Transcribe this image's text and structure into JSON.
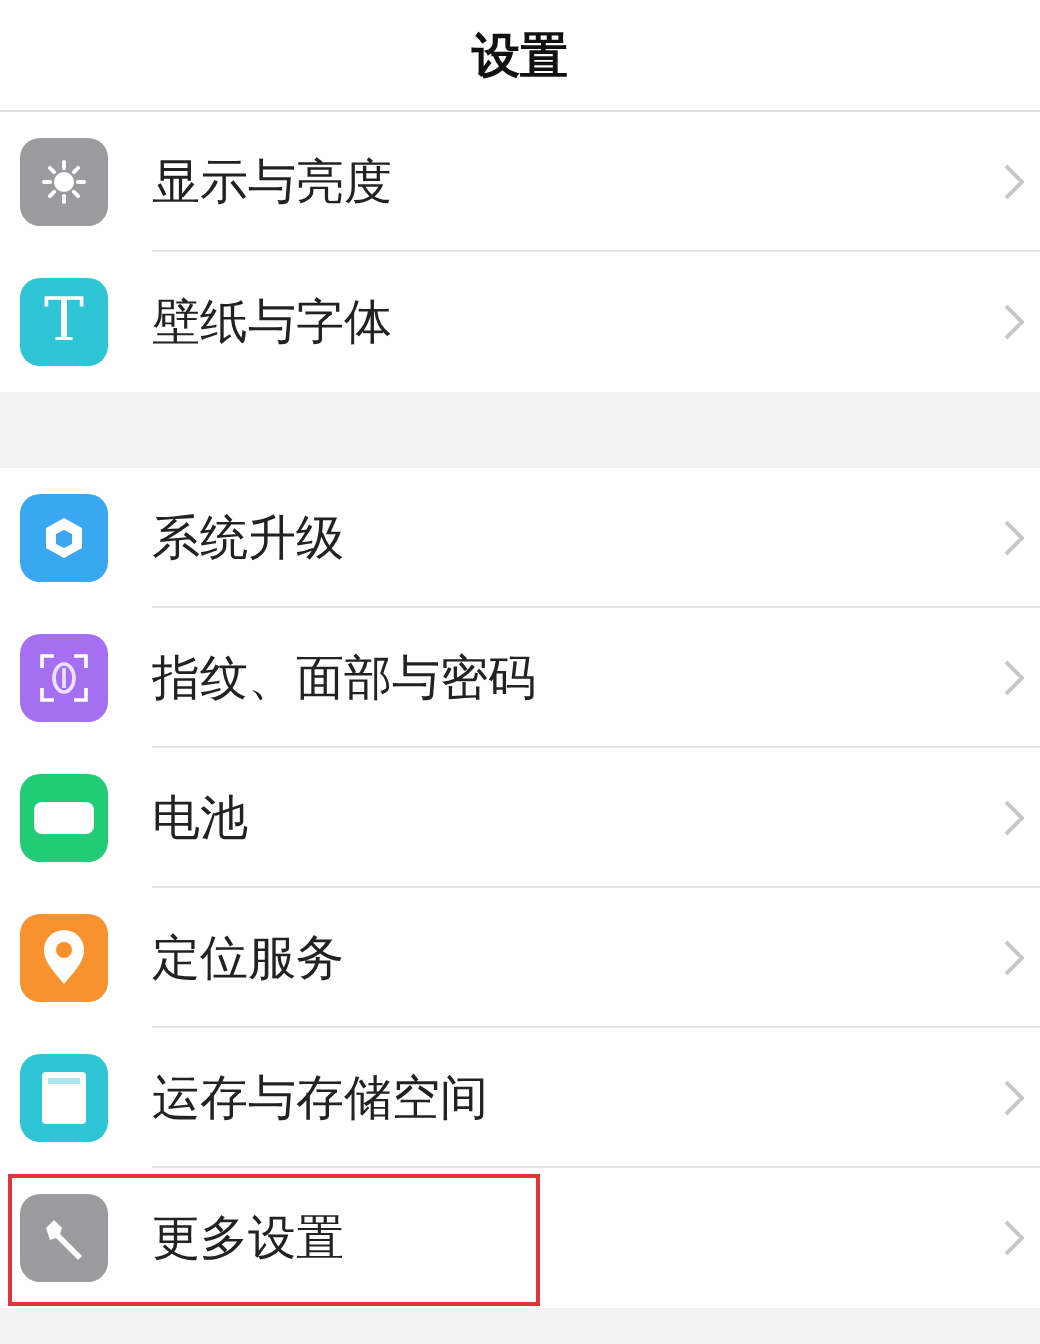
{
  "header": {
    "title": "设置"
  },
  "groups": [
    {
      "items": [
        {
          "label": "显示与亮度",
          "kind": "sun",
          "color": "#9b9b9f",
          "highlighted": false
        },
        {
          "label": "壁纸与字体",
          "kind": "letter",
          "glyph": "T",
          "color": "#2ec6d6",
          "highlighted": false
        }
      ]
    },
    {
      "items": [
        {
          "label": "系统升级",
          "kind": "cube",
          "color": "#3aa8f0",
          "highlighted": false
        },
        {
          "label": "指纹、面部与密码",
          "kind": "fingerprint",
          "color": "#a66ef0",
          "highlighted": false
        },
        {
          "label": "电池",
          "kind": "battery",
          "color": "#22cc77",
          "highlighted": false
        },
        {
          "label": "定位服务",
          "kind": "pin",
          "color": "#f7922e",
          "highlighted": false
        },
        {
          "label": "运存与存储空间",
          "kind": "card",
          "color": "#2ec6d6",
          "highlighted": false
        },
        {
          "label": "更多设置",
          "kind": "wrench",
          "color": "#9b9b9f",
          "highlighted": true
        }
      ]
    }
  ]
}
